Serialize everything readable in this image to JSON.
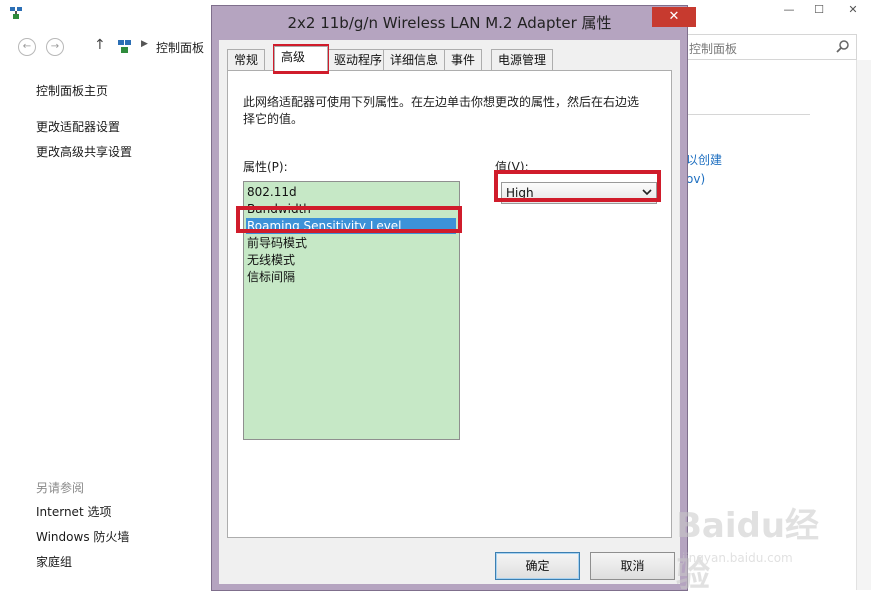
{
  "background": {
    "breadcrumb": "控制面板",
    "search_placeholder": "控制面板",
    "sidebar_links": [
      "控制面板主页",
      "更改适配器设置",
      "更改高级共享设置"
    ],
    "see_also_heading": "另请参阅",
    "see_also_links": [
      "Internet 选项",
      "Windows 防火墙",
      "家庭组"
    ],
    "right_peek_lines": [
      "以创建",
      "ov)"
    ],
    "nav_back_glyph": "←",
    "nav_forward_glyph": "→",
    "nav_up_glyph": "↑",
    "crumb_sep_glyph": "▶",
    "min_glyph": "—",
    "max_glyph": "☐",
    "close_glyph": "✕"
  },
  "dialog": {
    "title": "2x2 11b/g/n Wireless LAN M.2 Adapter 属性",
    "close_glyph": "✕",
    "tabs": [
      "常规",
      "高级",
      "驱动程序",
      "详细信息",
      "事件",
      "电源管理"
    ],
    "active_tab": "高级",
    "description": "此网络适配器可使用下列属性。在左边单击你想更改的属性，然后在右边选择它的值。",
    "property_label": "属性(P):",
    "value_label": "值(V):",
    "properties": [
      "802.11d",
      "Bandwidth",
      "Roaming Sensitivity Level",
      "前导码模式",
      "无线模式",
      "信标间隔"
    ],
    "selected_property": "Roaming Sensitivity Level",
    "value": "High",
    "ok_label": "确定",
    "cancel_label": "取消"
  },
  "watermark": {
    "line1": "Baidu经验",
    "line2": "jingyan.baidu.com"
  },
  "colors": {
    "highlight_box": "#d01c2b",
    "list_background": "#c6e8c6",
    "selection": "#3d92d8",
    "dialog_frame": "#b5a4c0",
    "close_button": "#c73a2f"
  }
}
